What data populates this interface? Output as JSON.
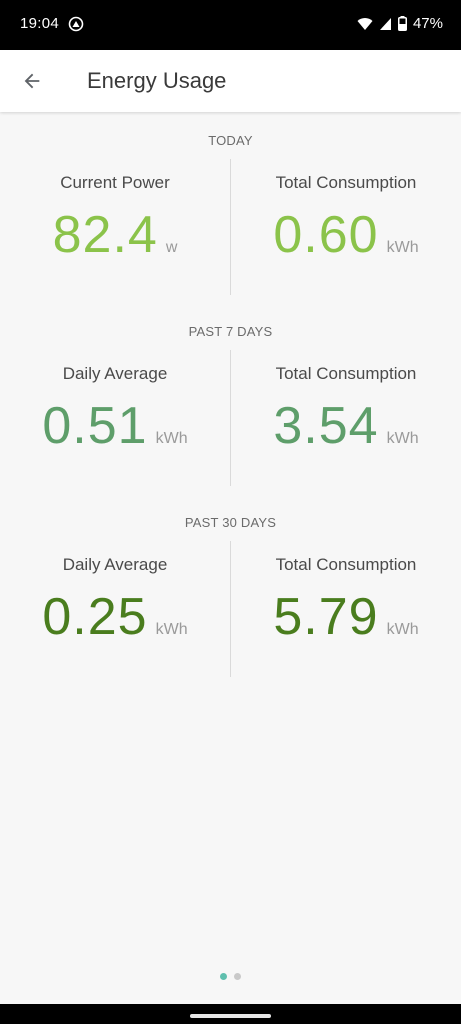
{
  "status_bar": {
    "time": "19:04",
    "battery": "47%"
  },
  "app_bar": {
    "title": "Energy Usage",
    "back_icon": "arrow-left-icon"
  },
  "sections": [
    {
      "header": "TODAY",
      "left": {
        "label": "Current Power",
        "value": "82.4",
        "unit": "w"
      },
      "right": {
        "label": "Total Consumption",
        "value": "0.60",
        "unit": "kWh"
      },
      "color": "#8bc34a"
    },
    {
      "header": "PAST 7 DAYS",
      "left": {
        "label": "Daily Average",
        "value": "0.51",
        "unit": "kWh"
      },
      "right": {
        "label": "Total Consumption",
        "value": "3.54",
        "unit": "kWh"
      },
      "color": "#5e9e6a"
    },
    {
      "header": "PAST 30 DAYS",
      "left": {
        "label": "Daily Average",
        "value": "0.25",
        "unit": "kWh"
      },
      "right": {
        "label": "Total Consumption",
        "value": "5.79",
        "unit": "kWh"
      },
      "color": "#4a7d1e"
    }
  ],
  "page_indicator": {
    "active_color": "#5fbfae",
    "inactive_color": "#c9c9c9",
    "active_index": 0,
    "count": 2
  }
}
